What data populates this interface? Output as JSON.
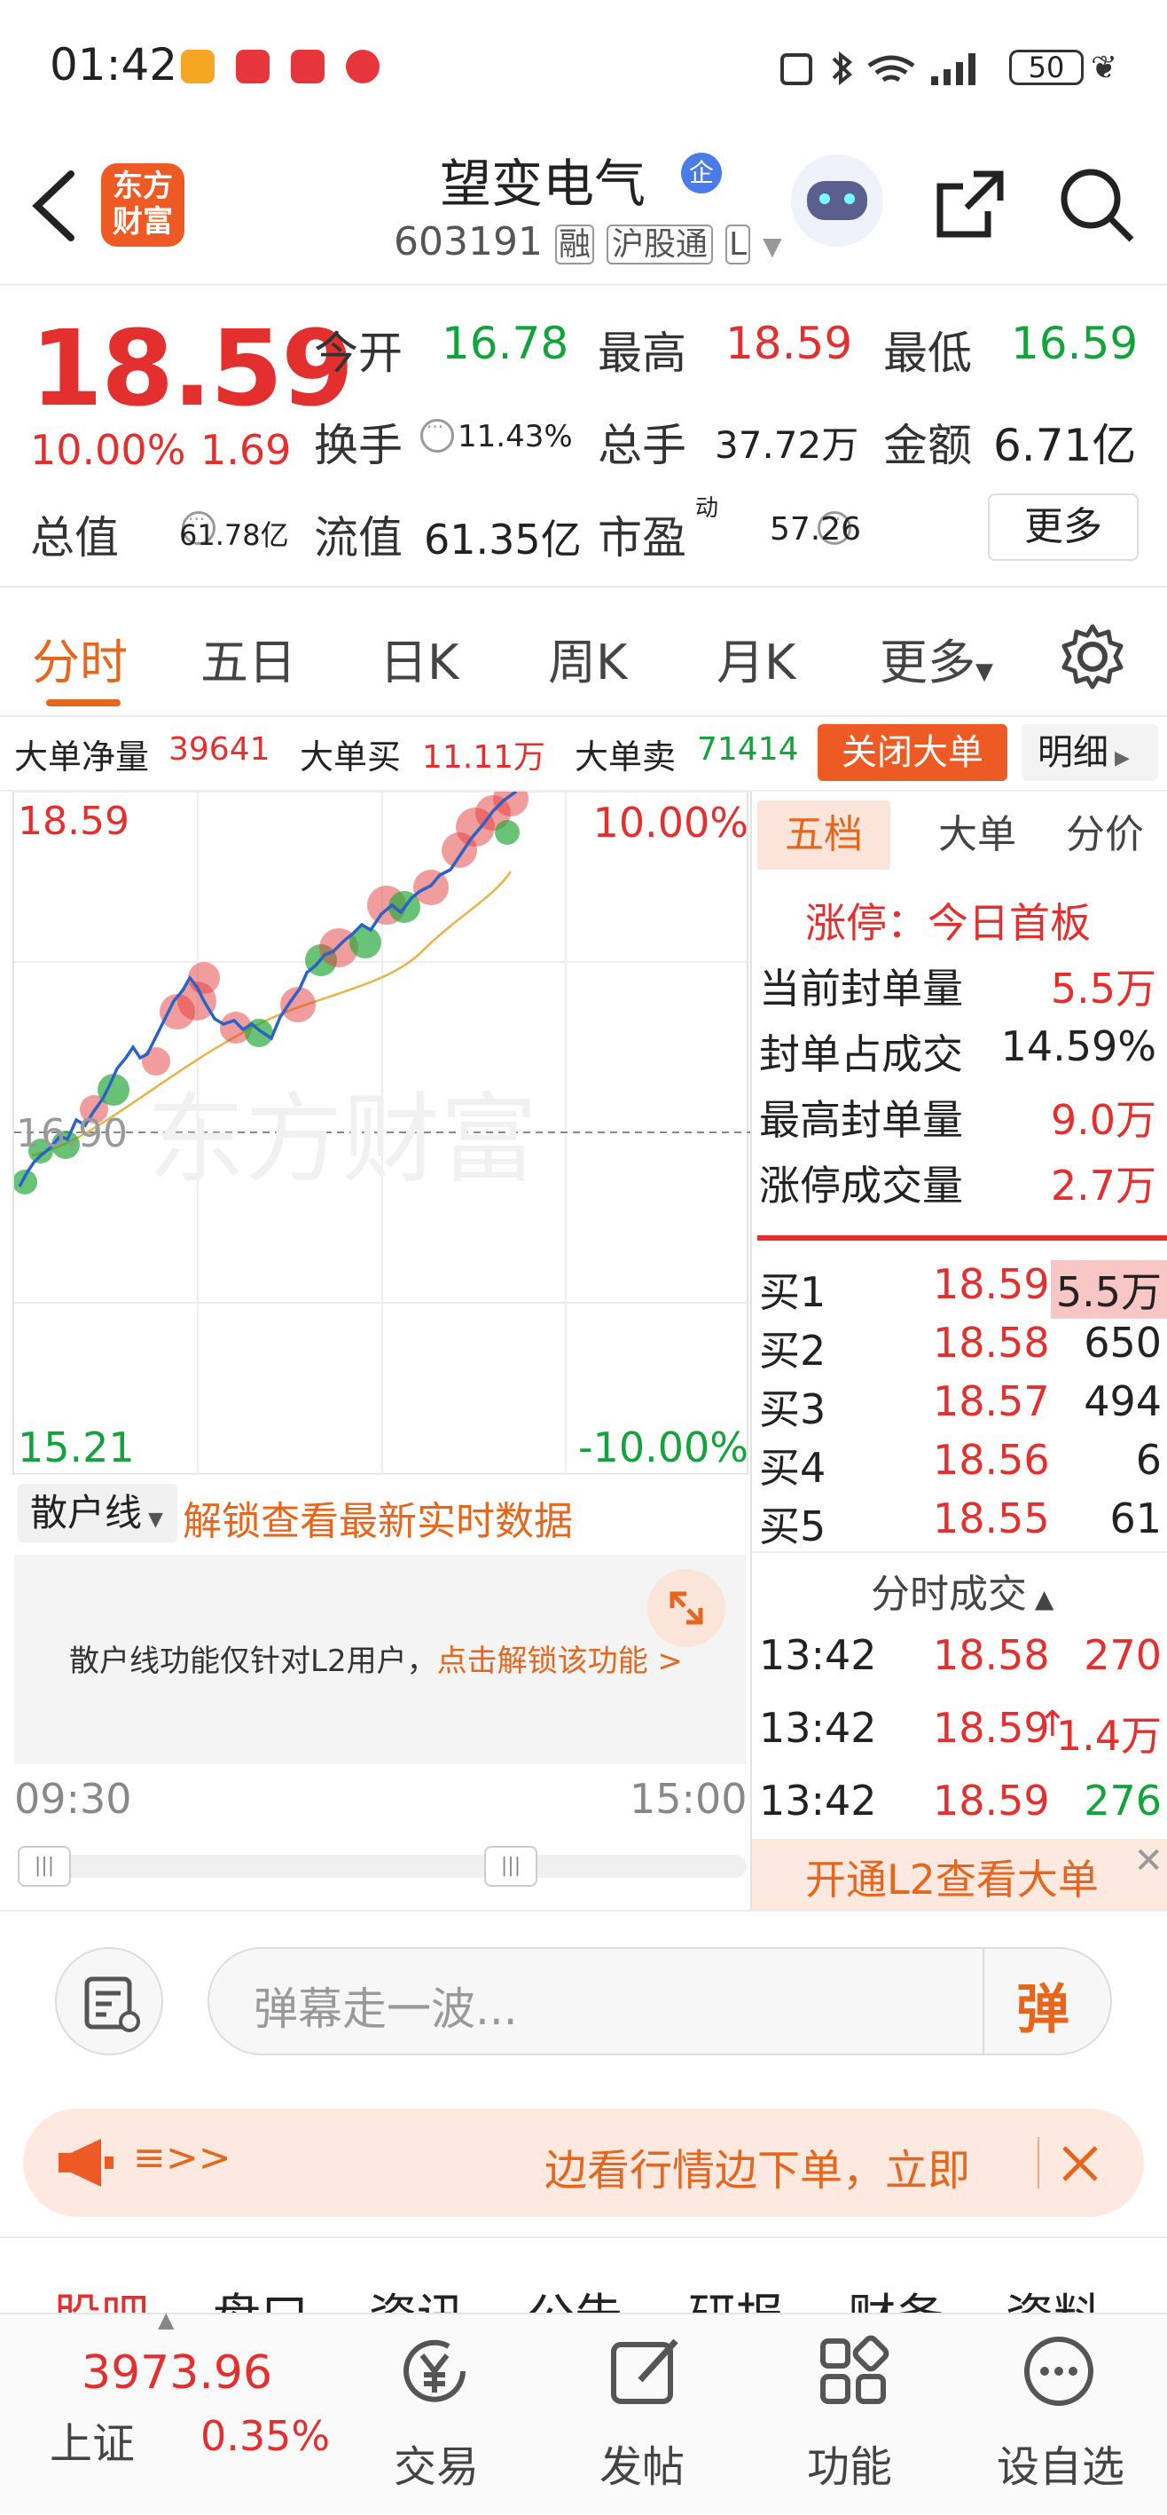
{
  "status_bar": {
    "time": "01:42",
    "battery": "50"
  },
  "header": {
    "logo_line1": "东方",
    "logo_line2": "财富",
    "stock_name": "望变电气",
    "badge": "企",
    "stock_code": "603191",
    "tag_margin": "融",
    "tag_connect": "沪股通",
    "tag_more": "L"
  },
  "quote": {
    "price": "18.59",
    "pct": "10.00%",
    "change": "1.69",
    "open_label": "今开",
    "open": "16.78",
    "high_label": "最高",
    "high": "18.59",
    "low_label": "最低",
    "low": "16.59",
    "turnover_label": "换手",
    "turnover": "11.43%",
    "volume_label": "总手",
    "volume": "37.72万",
    "amount_label": "金额",
    "amount": "6.71亿",
    "mktcap_label": "总值",
    "mktcap": "61.78亿",
    "float_label": "流值",
    "float": "61.35亿",
    "pe_label": "市盈",
    "pe_sup": "动",
    "pe": "57.26",
    "more": "更多"
  },
  "tabs": [
    "分时",
    "五日",
    "日K",
    "周K",
    "月K",
    "更多"
  ],
  "big_order": {
    "net_label": "大单净量",
    "net": "39641",
    "buy_label": "大单买",
    "buy": "11.11万",
    "sell_label": "大单卖",
    "sell": "71414",
    "close_btn": "关闭大单",
    "detail_btn": "明细"
  },
  "chart": {
    "top_price": "18.59",
    "top_pct": "10.00%",
    "mid_price": "16.90",
    "bottom_price": "15.21",
    "bottom_pct": "-10.00%",
    "watermark": "东方财富",
    "time_start": "09:30",
    "time_end": "15:00"
  },
  "retail": {
    "select": "散户线",
    "unlock": "解锁查看最新实时数据",
    "notice": "散户线功能仅针对L2用户，",
    "notice_link": "点击解锁该功能 >"
  },
  "side": {
    "tabs": [
      "五档",
      "大单",
      "分价"
    ],
    "limit_title": "涨停：今日首板",
    "stats": [
      {
        "label": "当前封单量",
        "value": "5.5万"
      },
      {
        "label": "封单占成交",
        "value": "14.59%"
      },
      {
        "label": "最高封单量",
        "value": "9.0万"
      },
      {
        "label": "涨停成交量",
        "value": "2.7万"
      }
    ],
    "bids": [
      {
        "label": "买1",
        "price": "18.59",
        "vol": "5.5万"
      },
      {
        "label": "买2",
        "price": "18.58",
        "vol": "650"
      },
      {
        "label": "买3",
        "price": "18.57",
        "vol": "494"
      },
      {
        "label": "买4",
        "price": "18.56",
        "vol": "6"
      },
      {
        "label": "买5",
        "price": "18.55",
        "vol": "61"
      }
    ],
    "ticks_title": "分时成交",
    "ticks": [
      {
        "time": "13:42",
        "price": "18.58",
        "vol": "270"
      },
      {
        "time": "13:42",
        "price": "18.59",
        "vol": "1.4万"
      },
      {
        "time": "13:42",
        "price": "18.59",
        "vol": "276"
      }
    ],
    "l2_promo": "开通L2查看大单"
  },
  "danmu": {
    "placeholder": "弹幕走一波...",
    "send": "弹"
  },
  "banner": {
    "left": "≡>>",
    "text": "边看行情边下单，立即"
  },
  "subtabs": [
    "股吧",
    "盘口",
    "资讯",
    "公告",
    "研报",
    "财务",
    "资料"
  ],
  "bottom": {
    "index_value": "3973.96",
    "index_name": "上证",
    "index_pct": "0.35%",
    "nav": [
      "交易",
      "发帖",
      "功能",
      "设自选"
    ]
  },
  "colors": {
    "up": "#e3302f",
    "down": "#13a33b",
    "accent": "#e5661c"
  }
}
